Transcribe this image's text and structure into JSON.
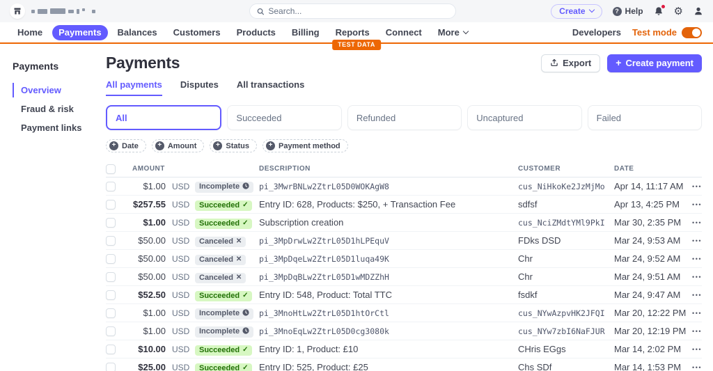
{
  "header": {
    "search": {
      "placeholder": "Search..."
    },
    "create_button": "Create",
    "help_label": "Help"
  },
  "nav": {
    "items": [
      {
        "label": "Home",
        "active": false
      },
      {
        "label": "Payments",
        "active": true
      },
      {
        "label": "Balances",
        "active": false
      },
      {
        "label": "Customers",
        "active": false
      },
      {
        "label": "Products",
        "active": false
      },
      {
        "label": "Billing",
        "active": false
      },
      {
        "label": "Reports",
        "active": false
      },
      {
        "label": "Connect",
        "active": false
      },
      {
        "label": "More",
        "active": false,
        "has_chevron": true
      }
    ],
    "developers": "Developers",
    "test_mode": "Test mode",
    "test_mode_on": true,
    "test_data_badge": "TEST DATA"
  },
  "sidebar": {
    "title": "Payments",
    "items": [
      {
        "label": "Overview",
        "active": true
      },
      {
        "label": "Fraud & risk",
        "active": false
      },
      {
        "label": "Payment links",
        "active": false
      }
    ]
  },
  "page": {
    "title": "Payments",
    "export_button": "Export",
    "create_payment_button": "Create payment",
    "tabs": [
      {
        "label": "All payments",
        "active": true
      },
      {
        "label": "Disputes",
        "active": false
      },
      {
        "label": "All transactions",
        "active": false
      }
    ],
    "filter_cards": [
      {
        "label": "All",
        "active": true
      },
      {
        "label": "Succeeded",
        "active": false
      },
      {
        "label": "Refunded",
        "active": false
      },
      {
        "label": "Uncaptured",
        "active": false
      },
      {
        "label": "Failed",
        "active": false
      }
    ],
    "filter_chips": [
      "Date",
      "Amount",
      "Status",
      "Payment method"
    ]
  },
  "table": {
    "columns": [
      "AMOUNT",
      "DESCRIPTION",
      "CUSTOMER",
      "DATE"
    ],
    "rows": [
      {
        "amount": "$1.00",
        "currency": "USD",
        "status": "incomplete",
        "status_label": "Incomplete",
        "description": "pi_3MwrBNLw2ZtrL05D0WOKAgW8",
        "description_mono": true,
        "customer": "cus_NiHkoKe2JzMjMo",
        "customer_mono": true,
        "date": "Apr 14, 11:17 AM",
        "bold": false
      },
      {
        "amount": "$257.55",
        "currency": "USD",
        "status": "succeeded",
        "status_label": "Succeeded",
        "description": "Entry ID: 628, Products: $250, + Transaction Fee",
        "description_mono": false,
        "customer": "sdfsf",
        "customer_mono": false,
        "date": "Apr 13, 4:25 PM",
        "bold": true
      },
      {
        "amount": "$1.00",
        "currency": "USD",
        "status": "succeeded",
        "status_label": "Succeeded",
        "description": "Subscription creation",
        "description_mono": false,
        "customer": "cus_NciZMdtYMl9PkI",
        "customer_mono": true,
        "date": "Mar 30, 2:35 PM",
        "bold": true
      },
      {
        "amount": "$50.00",
        "currency": "USD",
        "status": "canceled",
        "status_label": "Canceled",
        "description": "pi_3MpDrwLw2ZtrL05D1hLPEquV",
        "description_mono": true,
        "customer": "FDks DSD",
        "customer_mono": false,
        "date": "Mar 24, 9:53 AM",
        "bold": false
      },
      {
        "amount": "$50.00",
        "currency": "USD",
        "status": "canceled",
        "status_label": "Canceled",
        "description": "pi_3MpDqeLw2ZtrL05D1luqa49K",
        "description_mono": true,
        "customer": "Chr",
        "customer_mono": false,
        "date": "Mar 24, 9:52 AM",
        "bold": false
      },
      {
        "amount": "$50.00",
        "currency": "USD",
        "status": "canceled",
        "status_label": "Canceled",
        "description": "pi_3MpDqBLw2ZtrL05D1wMDZZhH",
        "description_mono": true,
        "customer": "Chr",
        "customer_mono": false,
        "date": "Mar 24, 9:51 AM",
        "bold": false
      },
      {
        "amount": "$52.50",
        "currency": "USD",
        "status": "succeeded",
        "status_label": "Succeeded",
        "description": "Entry ID: 548, Product: Total TTC",
        "description_mono": false,
        "customer": "fsdkf",
        "customer_mono": false,
        "date": "Mar 24, 9:47 AM",
        "bold": true
      },
      {
        "amount": "$1.00",
        "currency": "USD",
        "status": "incomplete",
        "status_label": "Incomplete",
        "description": "pi_3MnoHtLw2ZtrL05D1htOrCtl",
        "description_mono": true,
        "customer": "cus_NYwAzpvHK2JFQI",
        "customer_mono": true,
        "date": "Mar 20, 12:22 PM",
        "bold": false
      },
      {
        "amount": "$1.00",
        "currency": "USD",
        "status": "incomplete",
        "status_label": "Incomplete",
        "description": "pi_3MnoEqLw2ZtrL05D0cg3080k",
        "description_mono": true,
        "customer": "cus_NYw7zbI6NaFJUR",
        "customer_mono": true,
        "date": "Mar 20, 12:19 PM",
        "bold": false
      },
      {
        "amount": "$10.00",
        "currency": "USD",
        "status": "succeeded",
        "status_label": "Succeeded",
        "description": "Entry ID: 1, Product: £10",
        "description_mono": false,
        "customer": "CHris EGgs",
        "customer_mono": false,
        "date": "Mar 14, 2:02 PM",
        "bold": true
      },
      {
        "amount": "$25.00",
        "currency": "USD",
        "status": "succeeded",
        "status_label": "Succeeded",
        "description": "Entry ID: 525, Product: £25",
        "description_mono": false,
        "customer": "Chs SDf",
        "customer_mono": false,
        "date": "Mar 14, 1:53 PM",
        "bold": true
      }
    ]
  },
  "colors": {
    "accent_purple": "#635bff",
    "test_orange": "#ed6704",
    "test_mode_orange": "#e3630a",
    "succeeded_bg": "#d7f7c2",
    "succeeded_text": "#217005",
    "neutral_badge_bg": "#ebeef1",
    "neutral_badge_text": "#545969",
    "notification_red": "#df1b41"
  }
}
